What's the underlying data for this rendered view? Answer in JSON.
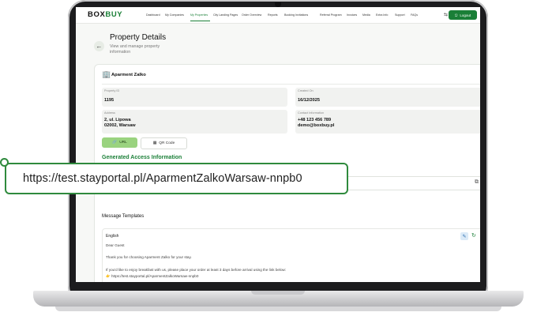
{
  "nav": {
    "logo_part1": "BOX",
    "logo_part2": "BUY",
    "items": [
      "Dashboard",
      "My Companies",
      "My Properties",
      "City Landing Pages",
      "Order Overview",
      "Reports",
      "Booking Invitations",
      "Referral Program",
      "Invoices",
      "Media",
      "Extra Info",
      "Support",
      "FAQs"
    ],
    "active_item": "My Properties",
    "logout_label": "Logout",
    "language_icon": "translate-icon",
    "bell_icon": "bell-icon"
  },
  "header": {
    "title": "Property Details",
    "subtitle": "View and manage property information"
  },
  "property": {
    "name": "Aparment Zalko",
    "fields": {
      "property_id": {
        "label": "Property ID",
        "value": "1195"
      },
      "created_on": {
        "label": "Created On",
        "value": "16/12/2025"
      },
      "address": {
        "label": "Address",
        "line1": "2, ul. Lipowa",
        "line2": "02002, Warsaw"
      },
      "contact": {
        "label": "Contact Information",
        "line1": "+48 123 456 789",
        "line2": "demo@boxbuy.pl"
      }
    }
  },
  "access": {
    "url_button": "URL",
    "qr_button": "QR Code",
    "section_title": "Generated Access Information",
    "url": "https://test.stayportal.pl/AparmentZalkoWarsaw-nnpb0"
  },
  "templates": {
    "section_title": "Message Templates",
    "language": "English",
    "lines": [
      "Dear Guest",
      "Thank you for choosing Aparment Zalko for your stay.",
      "If you'd like to enjoy breakfast with us, please place your order at least 3 days before arrival using the link below:",
      "👉 https://test.stayportal.pl/AparmentZalkoWarsaw-nnpb0"
    ]
  },
  "colors": {
    "brand": "#1a7f37",
    "url_button_bg": "#9ad37f",
    "callout_border": "#2f8a3d"
  }
}
